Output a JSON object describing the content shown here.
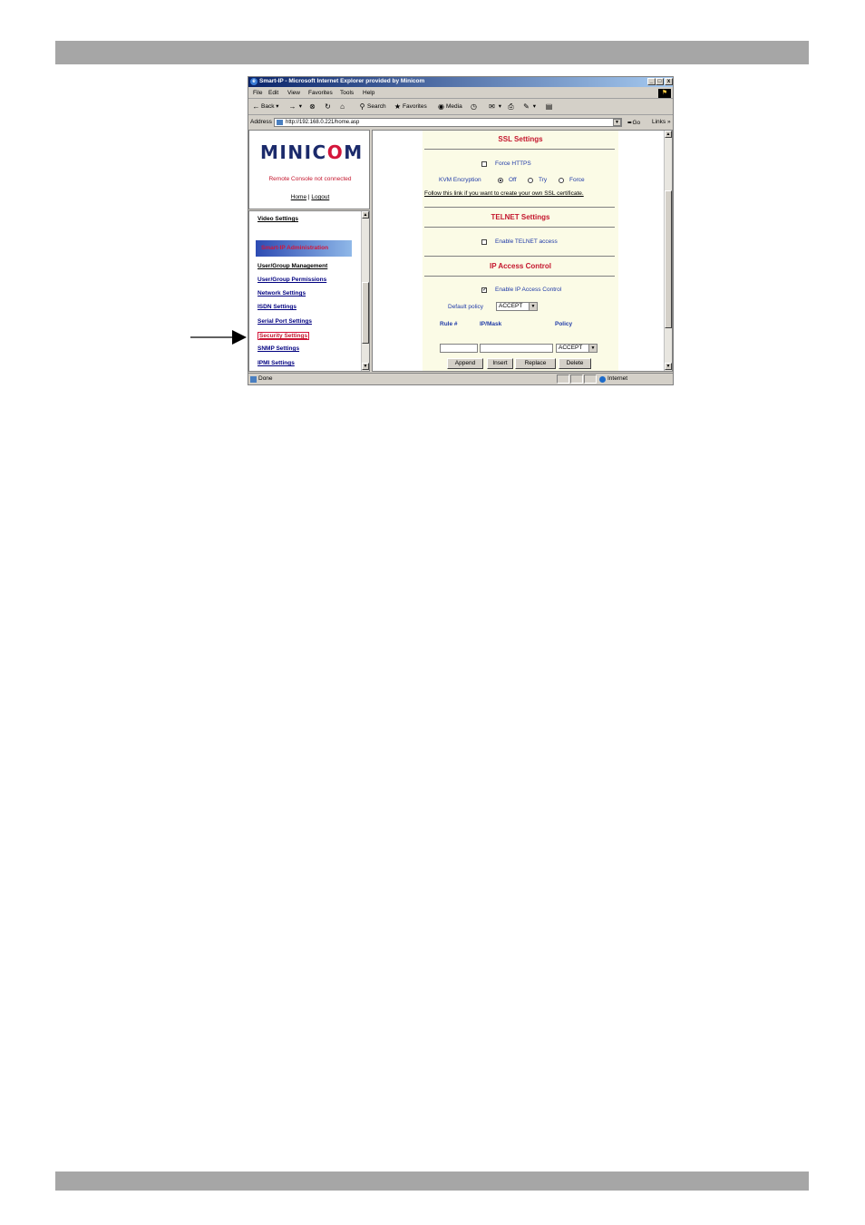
{
  "window": {
    "title": "Smart-IP - Microsoft Internet Explorer provided by Minicom",
    "controls": [
      "_",
      "□",
      "x"
    ]
  },
  "menu": [
    "File",
    "Edit",
    "View",
    "Favorites",
    "Tools",
    "Help"
  ],
  "toolbar": {
    "back": "Back",
    "search": "Search",
    "favorites": "Favorites",
    "media": "Media"
  },
  "address": {
    "label": "Address",
    "url": "http://192.168.0.221/home.asp",
    "go": "Go",
    "links": "Links »"
  },
  "left_top": {
    "logo": "MINICOM",
    "console_status": "Remote Console not connected",
    "home_link": "Home",
    "separator": "|",
    "logout_link": "Logout"
  },
  "left_nav": {
    "video_settings": "Video Settings",
    "admin_banner": "Smart-IP Administration",
    "items": [
      "User/Group Management",
      "User/Group Permissions",
      "Network Settings",
      "ISDN Settings",
      "Serial Port Settings",
      "Security Settings",
      "SNMP Settings",
      "IPMI Settings"
    ]
  },
  "ssl": {
    "title": "SSL Settings",
    "force_https": "Force HTTPS",
    "force_https_checked": false,
    "kvm_label": "KVM Encryption",
    "kvm_options": [
      "Off",
      "Try",
      "Force"
    ],
    "kvm_selected": "Off",
    "cert_link": "Follow this link if you want to create your own SSL certificate."
  },
  "telnet": {
    "title": "TELNET Settings",
    "enable_label": "Enable TELNET access",
    "enabled": false
  },
  "ip_access": {
    "title": "IP Access Control",
    "enable_label": "Enable IP Access Control",
    "enabled": true,
    "default_policy_label": "Default policy",
    "default_policy_value": "ACCEPT",
    "columns": [
      "Rule #",
      "IP/Mask",
      "Policy"
    ],
    "new_rule_policy": "ACCEPT",
    "buttons": [
      "Append",
      "Insert",
      "Replace",
      "Delete"
    ]
  },
  "status": {
    "text": "Done",
    "zone": "Internet"
  }
}
